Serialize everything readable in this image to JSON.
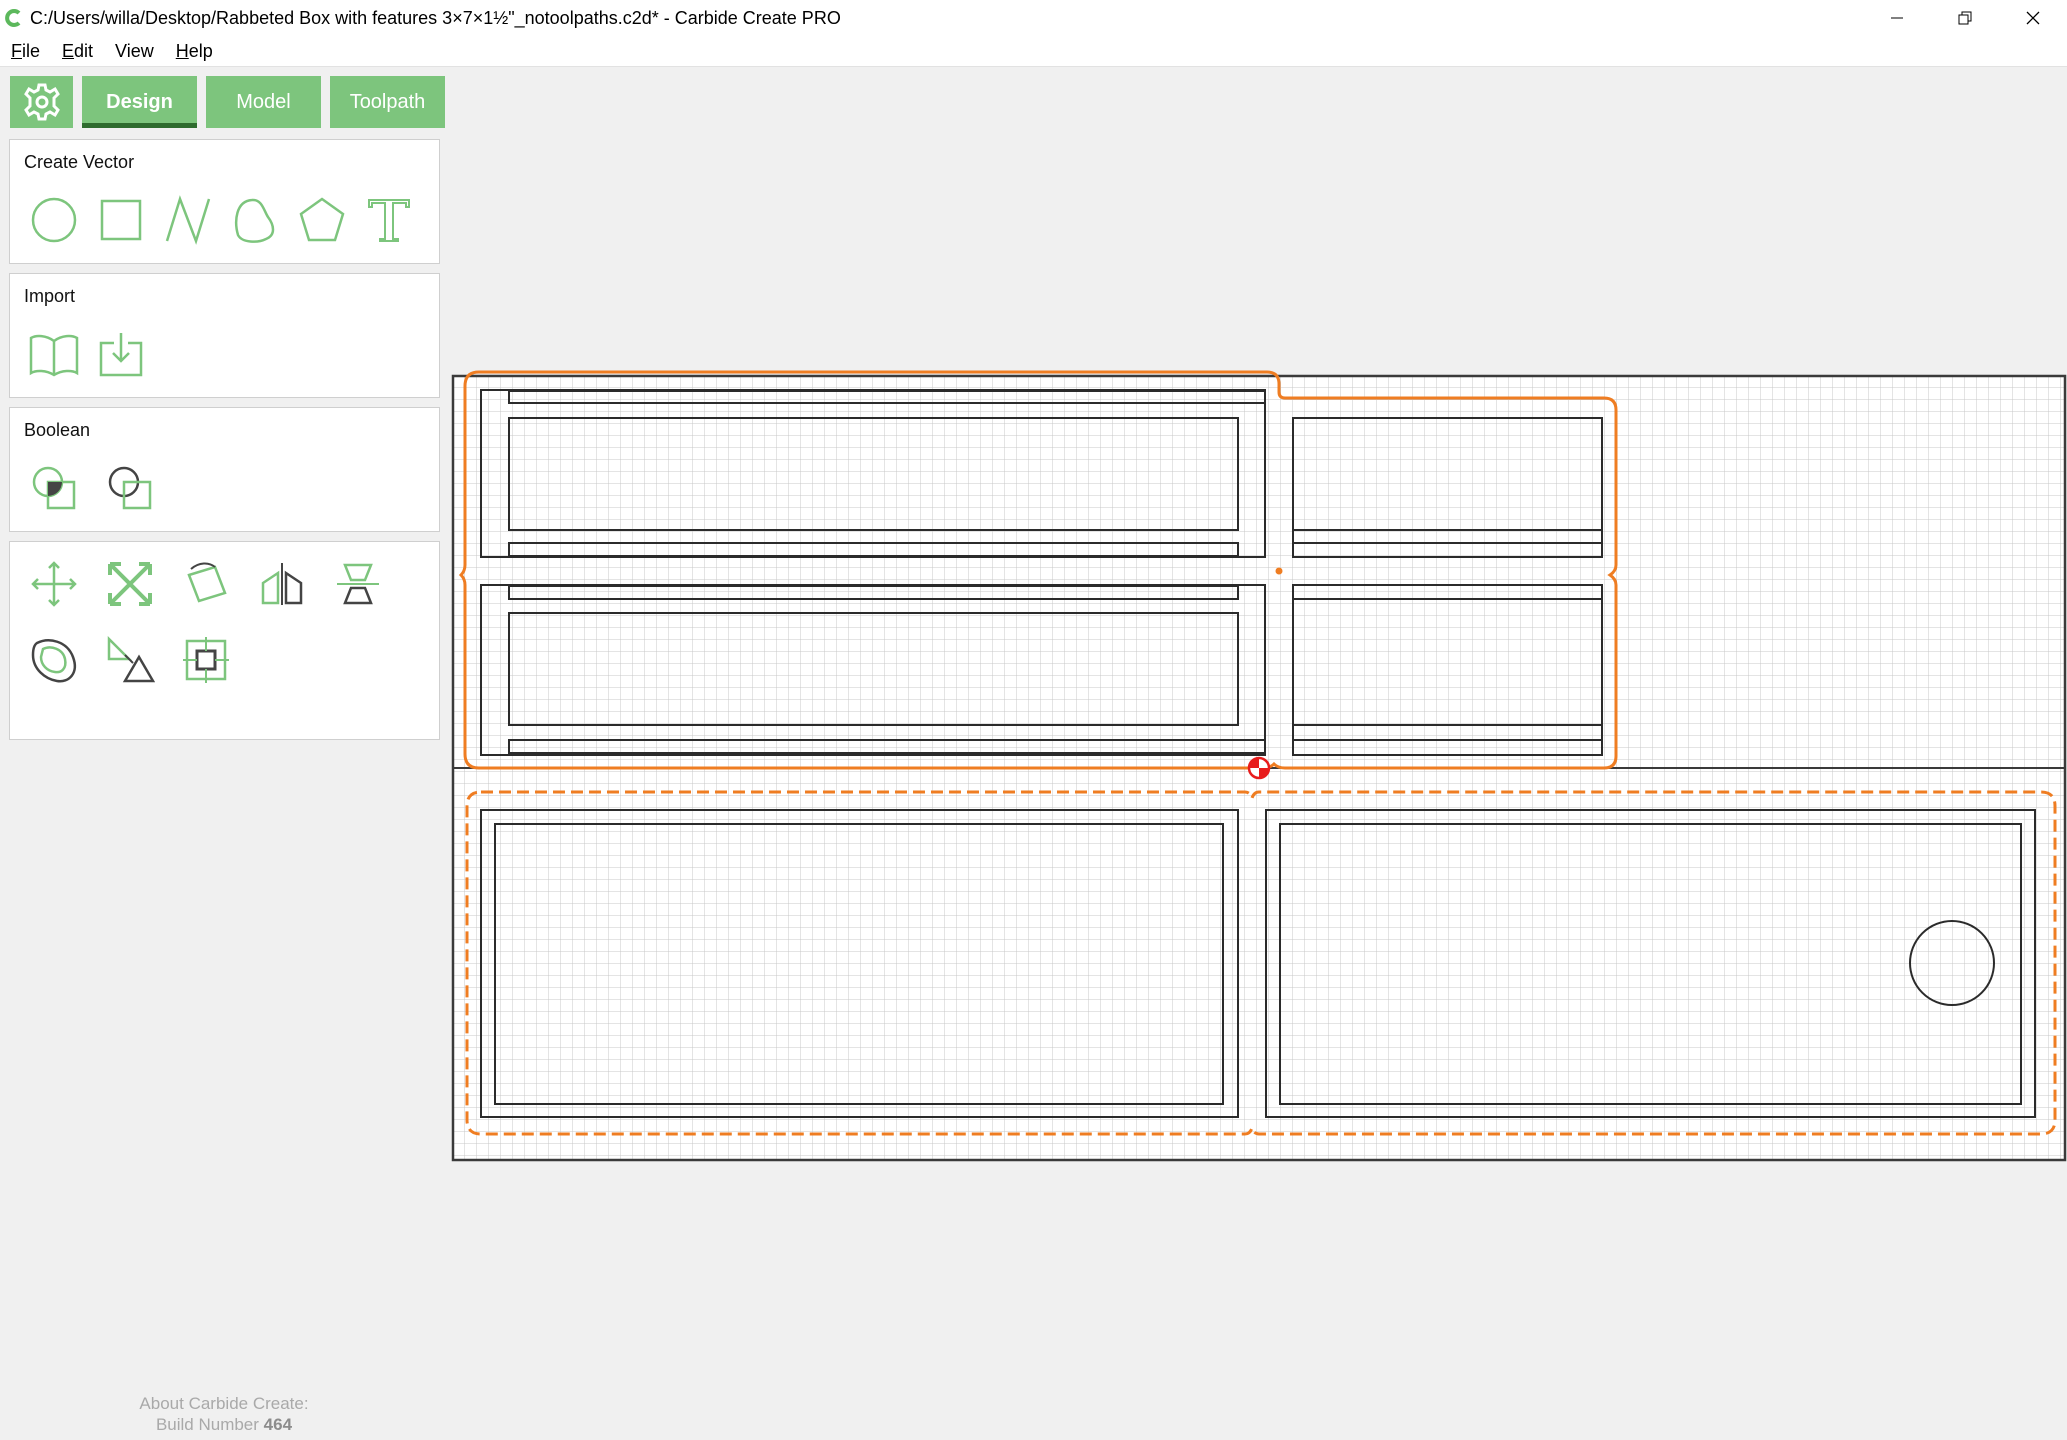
{
  "window": {
    "title": "C:/Users/willa/Desktop/Rabbeted Box with features 3×7×1½\"_notoolpaths.c2d* - Carbide Create PRO",
    "controls": [
      "minimize-icon",
      "restore-icon",
      "close-icon"
    ]
  },
  "menu": {
    "file": {
      "u": "F",
      "rest": "ile"
    },
    "edit": {
      "u": "E",
      "rest": "dit"
    },
    "view": {
      "u": "",
      "rest": "View"
    },
    "help": {
      "u": "H",
      "rest": "elp"
    }
  },
  "tabs": {
    "settings_icon": "gear-icon",
    "design": "Design",
    "model": "Model",
    "toolpath": "Toolpath",
    "active": "Design"
  },
  "panels": {
    "create_vector": {
      "title": "Create Vector",
      "tools": [
        "circle-icon",
        "rectangle-icon",
        "polyline-icon",
        "curve-icon",
        "polygon-icon",
        "text-icon"
      ]
    },
    "import": {
      "title": "Import",
      "tools": [
        "library-icon",
        "import-file-icon"
      ]
    },
    "boolean": {
      "title": "Boolean",
      "tools": [
        "boolean-union-icon",
        "boolean-subtract-icon"
      ]
    },
    "transform": {
      "tools": [
        "move-icon",
        "scale-icon",
        "rotate-icon",
        "mirror-icon",
        "align-icon",
        "offset-icon",
        "shear-icon",
        "transform-bounds-icon"
      ]
    }
  },
  "about": {
    "line1": "About Carbide Create:",
    "build_label": "Build Number",
    "build_number": "464"
  },
  "colors": {
    "accent": "#7dc57d",
    "accent_active_underline": "#2e6b2e",
    "toolpath_orange": "#ef7d22",
    "grid": "#c8c8c8",
    "stock_border": "#3a3a3a",
    "origin_marker": "#e81c1c"
  }
}
